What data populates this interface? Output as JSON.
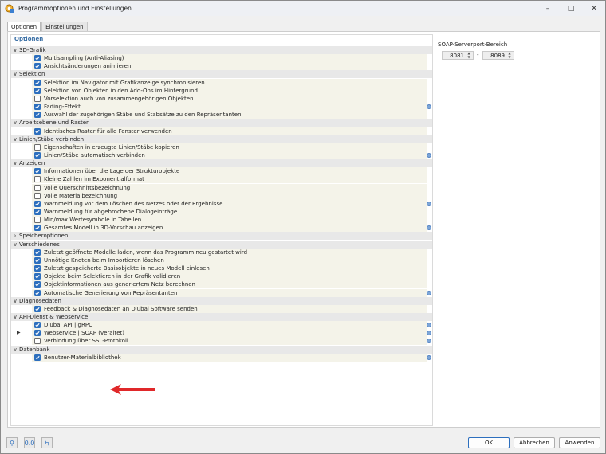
{
  "window": {
    "title": "Programmoptionen und Einstellungen",
    "minimize_icon": "minimize-icon",
    "maximize_icon": "maximize-icon",
    "close_icon": "close-icon"
  },
  "tabs": [
    {
      "label": "Optionen",
      "active": true
    },
    {
      "label": "Einstellungen",
      "active": false
    }
  ],
  "options": {
    "header": "Optionen",
    "sections": [
      {
        "label": "3D-Grafik",
        "expanded": true,
        "items": [
          {
            "label": "Multisampling (Anti-Aliasing)",
            "checked": true,
            "info": false
          },
          {
            "label": "Ansichtsänderungen animieren",
            "checked": true,
            "info": false
          }
        ]
      },
      {
        "label": "Selektion",
        "expanded": true,
        "items": [
          {
            "label": "Selektion im Navigator mit Grafikanzeige synchronisieren",
            "checked": true,
            "info": false
          },
          {
            "label": "Selektion von Objekten in den Add-Ons im Hintergrund",
            "checked": true,
            "info": false
          },
          {
            "label": "Vorselektion auch von zusammengehörigen Objekten",
            "checked": false,
            "info": false
          },
          {
            "label": "Fading-Effekt",
            "checked": true,
            "info": true
          },
          {
            "label": "Auswahl der zugehörigen Stäbe und Stabsätze zu den Repräsentanten",
            "checked": true,
            "info": false
          }
        ]
      },
      {
        "label": "Arbeitsebene und Raster",
        "expanded": true,
        "items": [
          {
            "label": "Identisches Raster für alle Fenster verwenden",
            "checked": true,
            "info": false
          }
        ]
      },
      {
        "label": "Linien/Stäbe verbinden",
        "expanded": true,
        "items": [
          {
            "label": "Eigenschaften in erzeugte Linien/Stäbe kopieren",
            "checked": false,
            "info": false
          },
          {
            "label": "Linien/Stäbe automatisch verbinden",
            "checked": true,
            "info": true
          }
        ]
      },
      {
        "label": "Anzeigen",
        "expanded": true,
        "items": [
          {
            "label": "Informationen über die Lage der Strukturobjekte",
            "checked": true,
            "info": false
          },
          {
            "label": "Kleine Zahlen im Exponentialformat",
            "checked": false,
            "info": false
          },
          {
            "label": "Volle Querschnittsbezeichnung",
            "checked": false,
            "info": false
          },
          {
            "label": "Volle Materialbezeichnung",
            "checked": false,
            "info": false
          },
          {
            "label": "Warnmeldung vor dem Löschen des Netzes oder der Ergebnisse",
            "checked": true,
            "info": true
          },
          {
            "label": "Warnmeldung für abgebrochene Dialogeinträge",
            "checked": true,
            "info": false
          },
          {
            "label": "Min/max Wertesymbole in Tabellen",
            "checked": false,
            "info": false
          },
          {
            "label": "Gesamtes Modell in 3D-Vorschau anzeigen",
            "checked": true,
            "info": true
          }
        ]
      },
      {
        "label": "Speicheroptionen",
        "expanded": false,
        "items": []
      },
      {
        "label": "Verschiedenes",
        "expanded": true,
        "items": [
          {
            "label": "Zuletzt geöffnete Modelle laden, wenn das Programm neu gestartet wird",
            "checked": true,
            "info": false
          },
          {
            "label": "Unnötige Knoten beim Importieren löschen",
            "checked": true,
            "info": false
          },
          {
            "label": "Zuletzt gespeicherte Basisobjekte in neues Modell einlesen",
            "checked": true,
            "info": false
          },
          {
            "label": "Objekte beim Selektieren in der Grafik validieren",
            "checked": true,
            "info": false
          },
          {
            "label": "Objektinformationen aus generiertem Netz berechnen",
            "checked": true,
            "info": false
          },
          {
            "label": "Automatische Generierung von Repräsentanten",
            "checked": true,
            "info": true
          }
        ]
      },
      {
        "label": "Diagnosedaten",
        "expanded": true,
        "items": [
          {
            "label": "Feedback & Diagnosedaten an Dlubal Software senden",
            "checked": true,
            "info": false
          }
        ]
      },
      {
        "label": "API-Dienst & Webservice",
        "expanded": true,
        "items": [
          {
            "label": "Dlubal API | gRPC",
            "checked": true,
            "info": true
          },
          {
            "label": "Webservice | SOAP (veraltet)",
            "checked": true,
            "info": true,
            "marker": true
          },
          {
            "label": "Verbindung über SSL-Protokoll",
            "checked": false,
            "info": true
          }
        ]
      },
      {
        "label": "Datenbank",
        "expanded": true,
        "items": [
          {
            "label": "Benutzer-Materialbibliothek",
            "checked": true,
            "info": true
          }
        ]
      }
    ]
  },
  "soap": {
    "title": "SOAP-Serverport-Bereich",
    "from": "8081",
    "separator": "-",
    "to": "8089"
  },
  "buttons": {
    "ok": "OK",
    "cancel": "Abbrechen",
    "apply": "Anwenden"
  },
  "colors": {
    "accent": "#2d6fbe",
    "annotation_arrow": "#e0282a"
  }
}
